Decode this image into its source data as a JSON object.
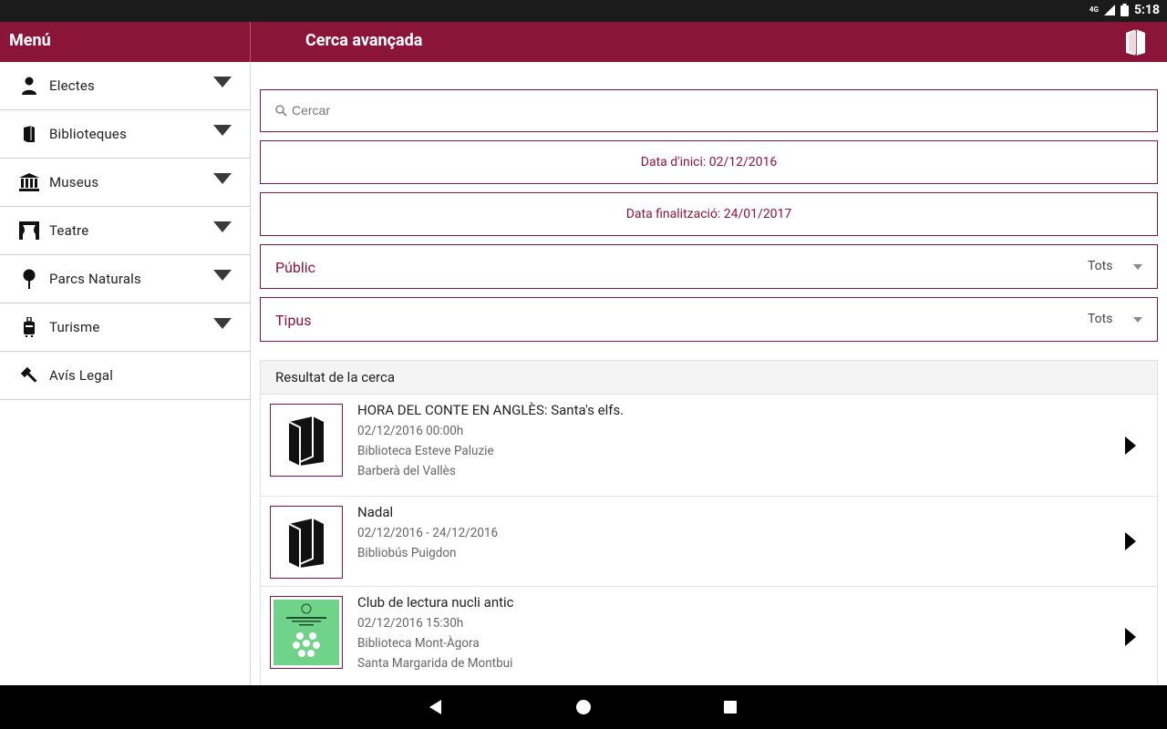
{
  "status_bar": {
    "network": "4G",
    "time": "5:18"
  },
  "toolbar": {
    "menu_title": "Menú",
    "page_title": "Cerca avançada"
  },
  "sidebar": {
    "items": [
      {
        "label": "Electes",
        "icon": "person-icon",
        "expandable": true
      },
      {
        "label": "Biblioteques",
        "icon": "book-icon",
        "expandable": true
      },
      {
        "label": "Museus",
        "icon": "museum-icon",
        "expandable": true
      },
      {
        "label": "Teatre",
        "icon": "theater-icon",
        "expandable": true
      },
      {
        "label": "Parcs Naturals",
        "icon": "tree-icon",
        "expandable": true
      },
      {
        "label": "Turisme",
        "icon": "luggage-icon",
        "expandable": true
      },
      {
        "label": "Avís Legal",
        "icon": "gavel-icon",
        "expandable": false
      }
    ]
  },
  "search": {
    "placeholder": "Cercar",
    "value": ""
  },
  "filters": {
    "start_date": "Data d'inici: 02/12/2016",
    "end_date": "Data finalització: 24/01/2017",
    "public": {
      "label": "Públic",
      "value": "Tots"
    },
    "type": {
      "label": "Tipus",
      "value": "Tots"
    }
  },
  "results": {
    "header": "Resultat de la cerca",
    "items": [
      {
        "title": "HORA DEL CONTE EN ANGLÈS: Santa's elfs.",
        "date": "02/12/2016 00:00h",
        "venue": "Biblioteca Esteve Paluzie",
        "city": "Barberà del Vallès",
        "thumb": "book-icon"
      },
      {
        "title": "Nadal",
        "date": "02/12/2016 - 24/12/2016",
        "venue": "Bibliobús Puigdon",
        "city": "",
        "thumb": "book-icon"
      },
      {
        "title": "Club de lectura nucli antic",
        "date": "02/12/2016 15:30h",
        "venue": "Biblioteca Mont-Àgora",
        "city": "Santa Margarida de Montbui",
        "thumb": "poster-image"
      }
    ]
  },
  "colors": {
    "accent": "#8a1538",
    "poster": "#6fd38a"
  }
}
